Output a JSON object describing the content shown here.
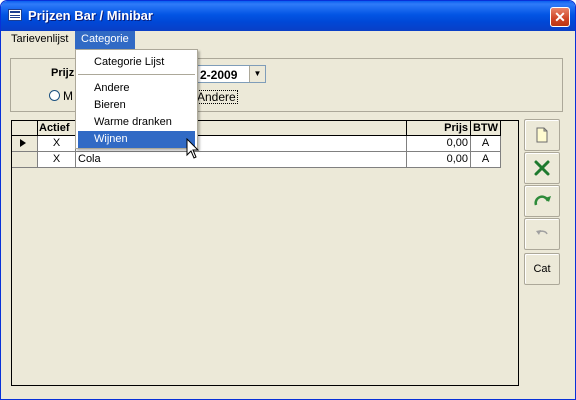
{
  "window": {
    "title": "Prijzen Bar / Minibar",
    "close_symbol": "✕"
  },
  "menubar": {
    "items": [
      "Tarievenlijst",
      "Categorie"
    ]
  },
  "dropdown": {
    "header_item": "Categorie Lijst",
    "items": [
      "Andere",
      "Bieren",
      "Warme dranken",
      "Wijnen"
    ]
  },
  "header": {
    "prijs_label": "Prijz",
    "date_value": "2-2009",
    "radio_label_left": "M",
    "radio_label_right": "Andere"
  },
  "grid": {
    "columns": {
      "actief": "Actief",
      "naam": "",
      "prijs": "Prijs",
      "btw": "BTW"
    },
    "rows": [
      {
        "actief": "X",
        "naam": "",
        "prijs": "0,00",
        "btw": "A"
      },
      {
        "actief": "X",
        "naam": "Cola",
        "prijs": "0,00",
        "btw": "A"
      }
    ]
  },
  "side_buttons": {
    "new": "new-record-icon",
    "delete": "delete-icon",
    "refresh": "refresh-icon",
    "undo": "undo-icon",
    "cat_label": "Cat"
  },
  "colors": {
    "title_blue": "#0047d6",
    "highlight": "#316ac5",
    "face": "#ece9d8"
  }
}
